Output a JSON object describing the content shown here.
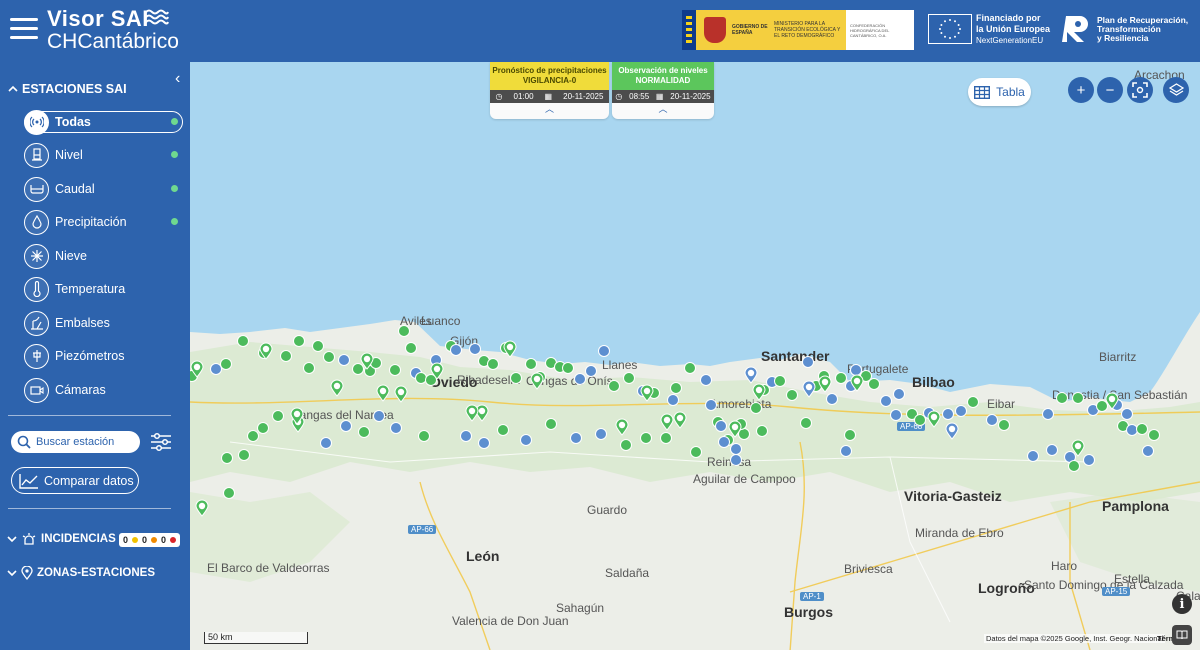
{
  "header": {
    "title_line1": "Visor SAI",
    "title_line2": "CHCantábrico",
    "gov_logo": {
      "gobierno": "GOBIERNO DE ESPAÑA",
      "ministerio": "MINISTERIO PARA LA TRANSICIÓN ECOLÓGICA Y EL RETO DEMOGRÁFICO",
      "confederacion": "CONFEDERACIÓN HIDROGRÁFICA DEL CANTÁBRICO, O.A."
    },
    "eu_funding": {
      "line1": "Financiado por",
      "line2": "la Unión Europea",
      "line3": "NextGenerationEU"
    },
    "recovery_plan": {
      "line1": "Plan de Recuperación,",
      "line2": "Transformación",
      "line3": "y Resiliencia"
    }
  },
  "sidebar": {
    "section_title": "ESTACIONES SAI",
    "stations": [
      {
        "label": "Todas",
        "icon": "signal-icon",
        "active": true,
        "dot": true
      },
      {
        "label": "Nivel",
        "icon": "level-icon",
        "active": false,
        "dot": true
      },
      {
        "label": "Caudal",
        "icon": "flow-icon",
        "active": false,
        "dot": true
      },
      {
        "label": "Precipitación",
        "icon": "drop-icon",
        "active": false,
        "dot": true
      },
      {
        "label": "Nieve",
        "icon": "snowflake-icon",
        "active": false,
        "dot": false
      },
      {
        "label": "Temperatura",
        "icon": "thermometer-icon",
        "active": false,
        "dot": false
      },
      {
        "label": "Embalses",
        "icon": "dam-icon",
        "active": false,
        "dot": false
      },
      {
        "label": "Piezómetros",
        "icon": "piezometer-icon",
        "active": false,
        "dot": false
      },
      {
        "label": "Cámaras",
        "icon": "camera-icon",
        "active": false,
        "dot": false
      }
    ],
    "search_placeholder": "Buscar estación",
    "compare_label": "Comparar datos",
    "incidents_label": "INCIDENCIAS",
    "incidents_counts": [
      "0",
      "0",
      "0"
    ],
    "incident_colors": [
      "#f2c200",
      "#f08a00",
      "#d9262b"
    ],
    "zones_label": "ZONAS-ESTACIONES"
  },
  "map": {
    "forecast_card": {
      "title": "Pronóstico de precipitaciones",
      "status": "VIGILANCIA-0",
      "time": "01:00",
      "date": "20-11-2025",
      "color": "#f0dc3a"
    },
    "observation_card": {
      "title": "Observación de niveles",
      "status": "NORMALIDAD",
      "time": "08:55",
      "date": "20-11-2025",
      "color": "#5cc65c"
    },
    "table_button": "Tabla",
    "controls": [
      "zoom-in-icon",
      "zoom-out-icon",
      "fullscreen-icon",
      "layers-icon"
    ],
    "scale_label": "50 km",
    "attribution": "Datos del mapa ©2025 Google, Inst. Geogr. Nacional",
    "terms": "Térm",
    "places": [
      {
        "name": "Avilés",
        "cls": ""
      },
      {
        "name": "Luanco",
        "cls": ""
      },
      {
        "name": "Gijón",
        "cls": ""
      },
      {
        "name": "Oviedo",
        "cls": "big"
      },
      {
        "name": "Llanes",
        "cls": ""
      },
      {
        "name": "Santander",
        "cls": "big"
      },
      {
        "name": "Bilbao",
        "cls": "big"
      },
      {
        "name": "Donostia / San Sebastián",
        "cls": ""
      },
      {
        "name": "Biarritz",
        "cls": ""
      },
      {
        "name": "Arcachon",
        "cls": ""
      },
      {
        "name": "Eibar",
        "cls": ""
      },
      {
        "name": "Portugalete",
        "cls": ""
      },
      {
        "name": "Reinosa",
        "cls": ""
      },
      {
        "name": "Vitoria-Gasteiz",
        "cls": "big"
      },
      {
        "name": "Pamplona",
        "cls": "big"
      },
      {
        "name": "Aguilar de Campoo",
        "cls": ""
      },
      {
        "name": "Guardo",
        "cls": ""
      },
      {
        "name": "León",
        "cls": "big"
      },
      {
        "name": "Saldaña",
        "cls": ""
      },
      {
        "name": "Sahagún",
        "cls": ""
      },
      {
        "name": "Burgos",
        "cls": "big"
      },
      {
        "name": "Briviesca",
        "cls": ""
      },
      {
        "name": "Miranda de Ebro",
        "cls": ""
      },
      {
        "name": "Logroño",
        "cls": "big"
      },
      {
        "name": "Haro",
        "cls": ""
      },
      {
        "name": "Santo Domingo de la Calzada",
        "cls": ""
      },
      {
        "name": "Estella",
        "cls": ""
      },
      {
        "name": "Calahorra",
        "cls": ""
      },
      {
        "name": "Cangas del Narcea",
        "cls": ""
      },
      {
        "name": "Cangas de Onís",
        "cls": ""
      },
      {
        "name": "Ribadesella",
        "cls": ""
      },
      {
        "name": "Amorebieta",
        "cls": ""
      },
      {
        "name": "El Barco de Valdeorras",
        "cls": ""
      },
      {
        "name": "Valencia de Don Juan",
        "cls": ""
      }
    ],
    "roads": [
      "AP-66",
      "AP-68",
      "AP-1",
      "AP-15"
    ]
  }
}
